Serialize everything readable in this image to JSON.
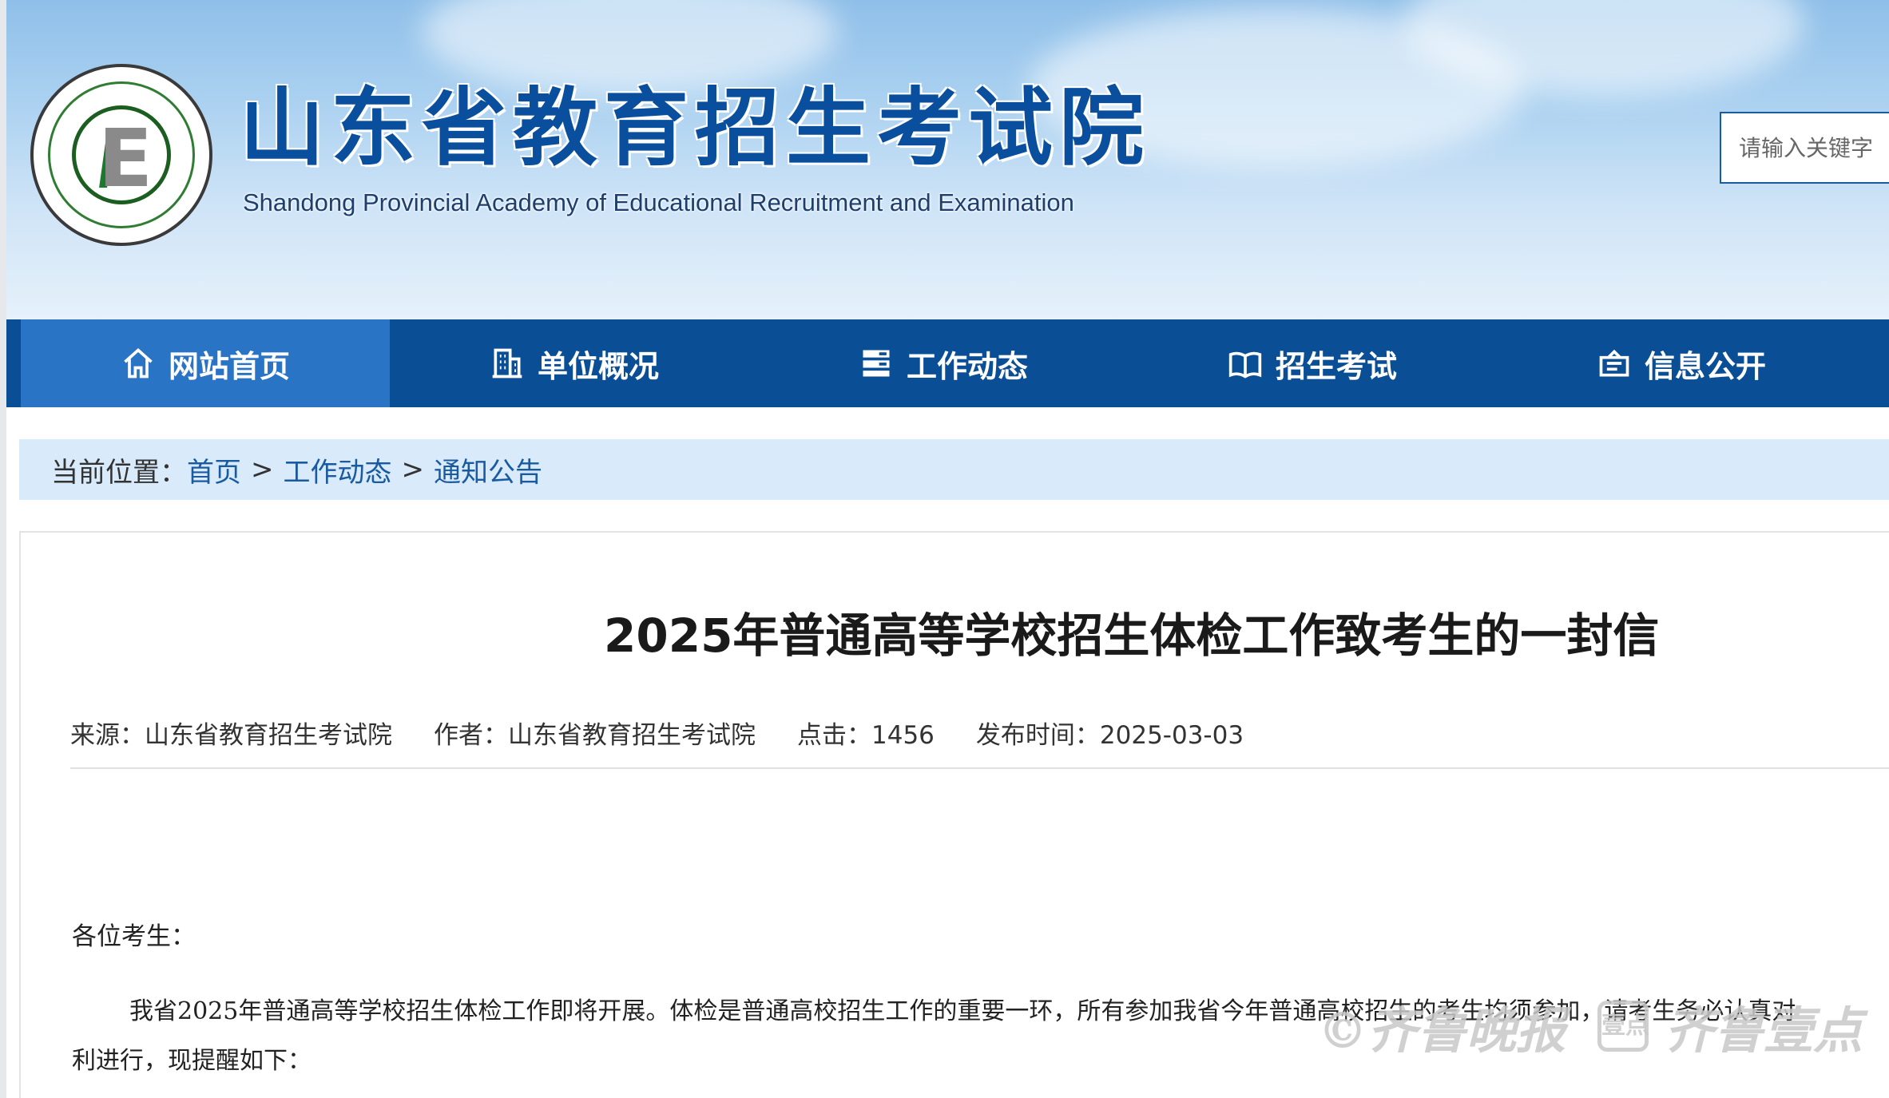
{
  "header": {
    "site_title": "山东省教育招生考试院",
    "site_subtitle": "Shandong Provincial Academy of Educational Recruitment and Examination",
    "search_placeholder": "请输入关键字"
  },
  "nav": {
    "items": [
      {
        "label": "网站首页",
        "icon": "home-icon"
      },
      {
        "label": "单位概况",
        "icon": "building-icon"
      },
      {
        "label": "工作动态",
        "icon": "list-icon"
      },
      {
        "label": "招生考试",
        "icon": "book-icon"
      },
      {
        "label": "信息公开",
        "icon": "info-box-icon"
      }
    ],
    "active_index": 0
  },
  "breadcrumb": {
    "prefix": "当前位置：",
    "items": [
      "首页",
      "工作动态",
      "通知公告"
    ],
    "separator": ">"
  },
  "article": {
    "title": "2025年普通高等学校招生体检工作致考生的一封信",
    "meta": {
      "source": "来源：山东省教育招生考试院",
      "author": "作者：山东省教育招生考试院",
      "clicks": "点击：1456",
      "date": "发布时间：2025-03-03"
    },
    "salutation": "各位考生：",
    "para1": "我省2025年普通高等学校招生体检工作即将开展。体检是普通高校招生工作的重要一环，所有参加我省今年普通高校招生的考生均须参加，请考生务必认真对",
    "para2": "利进行，现提醒如下："
  },
  "watermark": {
    "text_left": "©齐鲁晚报",
    "badge": "壹点",
    "text_right": "齐鲁壹点"
  },
  "colors": {
    "nav_bg": "#0a4f95",
    "nav_active": "#2a74c6",
    "title_blue": "#0a4f9e",
    "breadcrumb_bg": "#d9ebfb",
    "link_blue": "#1a5aa0"
  }
}
